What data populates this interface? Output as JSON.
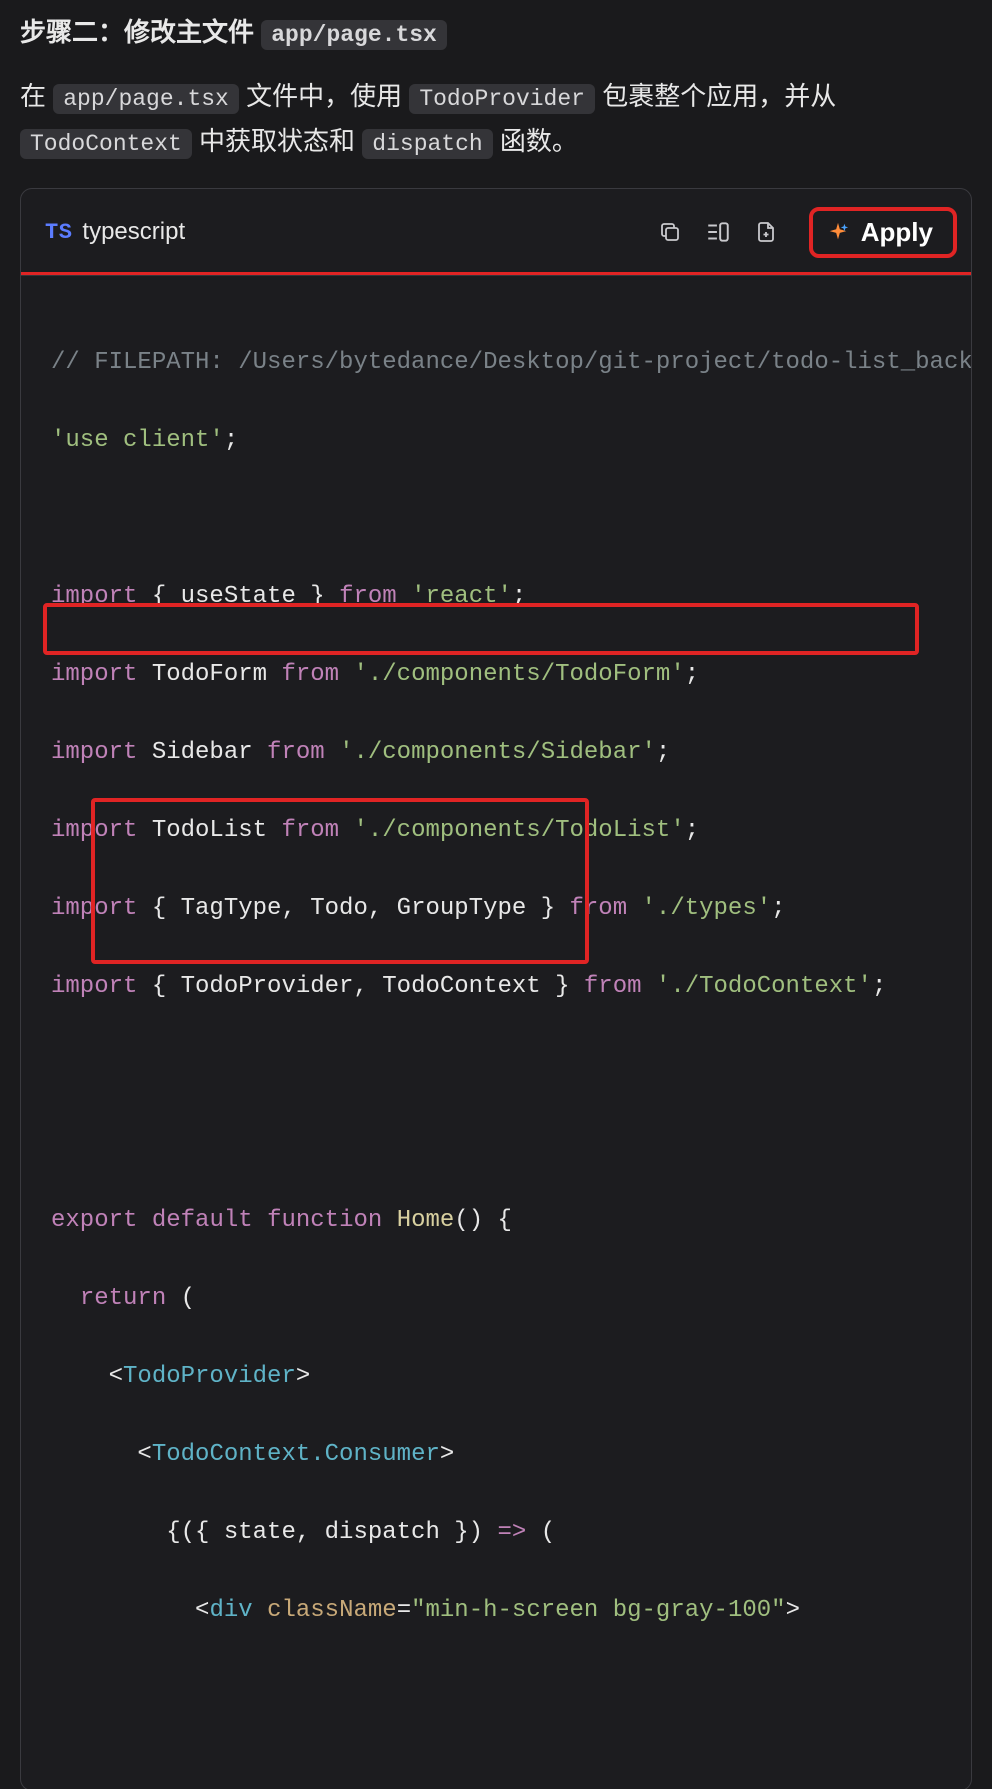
{
  "heading_prefix": "步骤二：修改主文件 ",
  "heading_code": "app/page.tsx",
  "para": {
    "t1": "在 ",
    "c1": "app/page.tsx",
    "t2": " 文件中，使用 ",
    "c2": "TodoProvider",
    "t3": " 包裹整个应用，并从 ",
    "c3": "TodoContext",
    "t4": " 中获取状态和 ",
    "c4": "dispatch",
    "t5": " 函数。"
  },
  "codeHeader": {
    "tsBadge": "TS",
    "lang": "typescript",
    "applyLabel": "Apply"
  },
  "code": {
    "l1_comment": "// FILEPATH: /Users/bytedance/Desktop/git-project/todo-list_back/",
    "l2_str": "'use client'",
    "l4_kw_import": "import",
    "l4_id": " { useState } ",
    "l4_kw_from": "from",
    "l4_str": "'react'",
    "l5_id": " TodoForm ",
    "l5_str": "'./components/TodoForm'",
    "l6_id": " Sidebar ",
    "l6_str": "'./components/Sidebar'",
    "l7_id": " TodoList ",
    "l7_str": "'./components/TodoList'",
    "l8_id": " { TagType, Todo, GroupType } ",
    "l8_str": "'./types'",
    "l9_id": " { TodoProvider, TodoContext } ",
    "l9_str": "'./TodoContext'",
    "l11_export": "export",
    "l11_default": "default",
    "l11_function": "function",
    "l11_name": "Home",
    "l12_return": "return",
    "tag1": "TodoProvider",
    "tag2": "TodoContext.Consumer",
    "l15_a": "{({ state, dispatch }) ",
    "l15_b": "=>",
    "l15_c": " (",
    "divTag": "div",
    "classNameAttr": "className",
    "classNameVal": "\"min-h-screen bg-gray-100\"",
    "semi": ";",
    "paren_open": "(",
    "paren_close_open": "() {",
    "angle_open": "<",
    "angle_close": ">",
    "eq": "="
  }
}
